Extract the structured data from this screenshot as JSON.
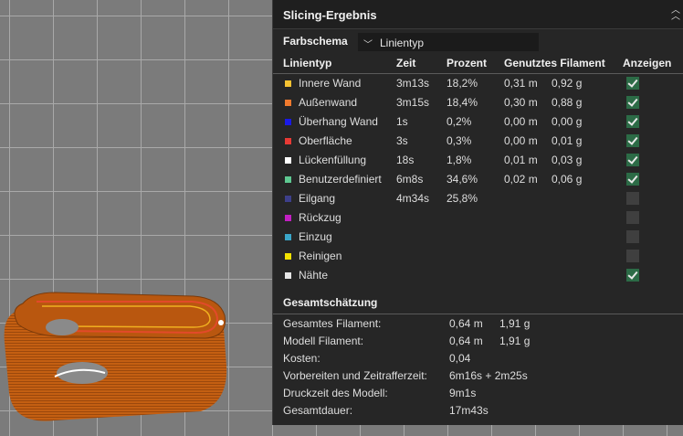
{
  "panel": {
    "title": "Slicing-Ergebnis",
    "color_scheme_label": "Farbschema",
    "color_scheme_value": "Linientyp"
  },
  "table": {
    "headers": [
      "Linientyp",
      "Zeit",
      "Prozent",
      "Genutztes Filament",
      "Anzeigen"
    ],
    "rows": [
      {
        "name": "Innere Wand",
        "color": "#f5c232",
        "time": "3m13s",
        "percent": "18,2%",
        "len": "0,31 m",
        "weight": "0,92 g",
        "shown": true
      },
      {
        "name": "Außenwand",
        "color": "#f07a2e",
        "time": "3m15s",
        "percent": "18,4%",
        "len": "0,30 m",
        "weight": "0,88 g",
        "shown": true
      },
      {
        "name": "Überhang Wand",
        "color": "#1a1ae6",
        "time": "1s",
        "percent": "0,2%",
        "len": "0,00 m",
        "weight": "0,00 g",
        "shown": true
      },
      {
        "name": "Oberfläche",
        "color": "#e83a35",
        "time": "3s",
        "percent": "0,3%",
        "len": "0,00 m",
        "weight": "0,01 g",
        "shown": true
      },
      {
        "name": "Lückenfüllung",
        "color": "#ffffff",
        "time": "18s",
        "percent": "1,8%",
        "len": "0,01 m",
        "weight": "0,03 g",
        "shown": true
      },
      {
        "name": "Benutzerdefiniert",
        "color": "#5ec891",
        "time": "6m8s",
        "percent": "34,6%",
        "len": "0,02 m",
        "weight": "0,06 g",
        "shown": true
      },
      {
        "name": "Eilgang",
        "color": "#3d3f8a",
        "time": "4m34s",
        "percent": "25,8%",
        "len": "",
        "weight": "",
        "shown": false
      },
      {
        "name": "Rückzug",
        "color": "#c21fc2",
        "time": "",
        "percent": "",
        "len": "",
        "weight": "",
        "shown": false
      },
      {
        "name": "Einzug",
        "color": "#3aa6c9",
        "time": "",
        "percent": "",
        "len": "",
        "weight": "",
        "shown": false
      },
      {
        "name": "Reinigen",
        "color": "#f2e200",
        "time": "",
        "percent": "",
        "len": "",
        "weight": "",
        "shown": false
      },
      {
        "name": "Nähte",
        "color": "#e6e6e6",
        "time": "",
        "percent": "",
        "len": "",
        "weight": "",
        "shown": true
      }
    ]
  },
  "estimate": {
    "title": "Gesamtschätzung",
    "rows": [
      {
        "label": "Gesamtes Filament:",
        "value": "0,64 m",
        "value2": "1,91 g"
      },
      {
        "label": "Modell Filament:",
        "value": "0,64 m",
        "value2": "1,91 g"
      },
      {
        "label": "Kosten:",
        "value": "0,04",
        "value2": ""
      },
      {
        "label": "Vorbereiten und Zeitrafferzeit:",
        "value": "6m16s + 2m25s",
        "value2": ""
      },
      {
        "label": "Druckzeit des Modell:",
        "value": "9m1s",
        "value2": ""
      },
      {
        "label": "Gesamtdauer:",
        "value": "17m43s",
        "value2": ""
      }
    ]
  },
  "icons": {
    "collapse": "collapse-icon",
    "dropdown": "chevron-down-icon",
    "checkbox": "checkbox-icon"
  }
}
